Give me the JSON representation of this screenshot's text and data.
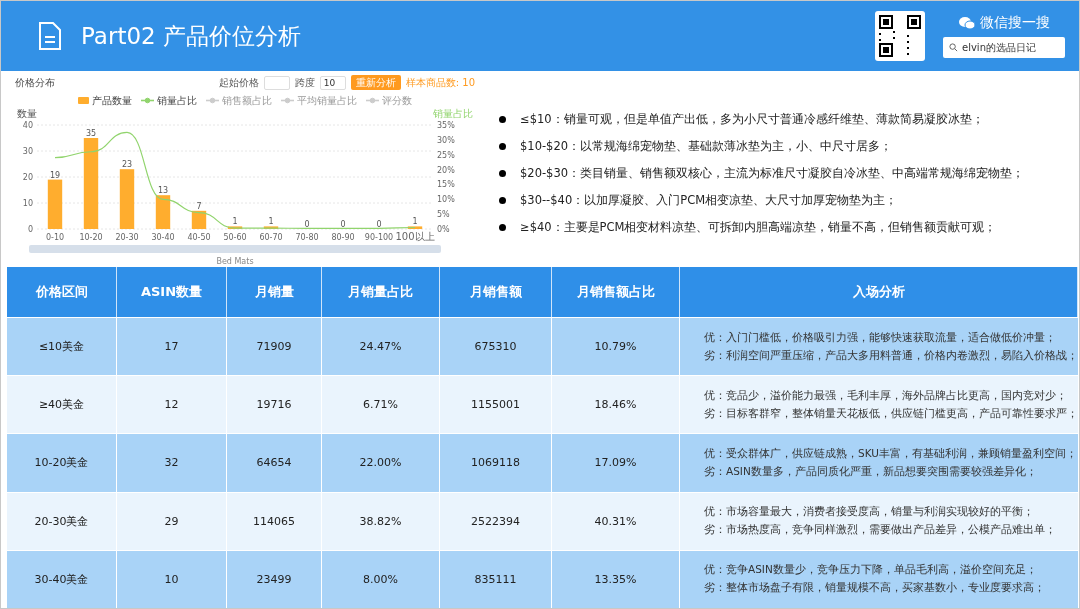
{
  "header": {
    "title": "Part02 产品价位分析",
    "wechat_label": "微信搜一搜",
    "search_value": "elvin的选品日记"
  },
  "chart_panel": {
    "title": "价格分布",
    "start_price_label": "起始价格",
    "span_label": "跨度",
    "span_value": "10",
    "analyze_button": "重新分析",
    "sample_count": "样本商品数: 10",
    "legend": [
      {
        "kind": "series",
        "selected": true
      },
      {
        "kind": "series",
        "selected": true
      },
      {
        "label": "销售额占比",
        "kind": "line",
        "selected": false
      },
      {
        "label": "平均销量占比",
        "kind": "line",
        "selected": false
      },
      {
        "label": "评分数",
        "kind": "line",
        "selected": false
      }
    ],
    "chart_data": {
      "type": "bar",
      "xlabel": "Bed Mats",
      "ylabel": "数量",
      "categories": [
        "0-10",
        "10-20",
        "20-30",
        "30-40",
        "40-50",
        "50-60",
        "60-70",
        "70-80",
        "80-90",
        "90-100",
        "100以上"
      ],
      "series": [
        {
          "name": "产品数量",
          "color": "#ffad2e",
          "values": [
            19,
            35,
            23,
            13,
            7,
            1,
            1,
            0,
            0,
            0,
            1
          ],
          "value_labels": [
            "19",
            "35",
            "23",
            "13",
            "7",
            "1",
            "1",
            "0",
            "0",
            "0",
            "1"
          ]
        },
        {
          "name": "销量占比",
          "type": "line",
          "axis": "y2",
          "color": "#91d46d",
          "values": [
            24,
            26,
            32.5,
            10,
            5.5,
            0.3,
            0.3,
            0.2,
            0.2,
            0.2,
            0.5
          ]
        }
      ],
      "grid": true,
      "ylim": [
        0,
        40
      ],
      "yticks": [
        0,
        10,
        20,
        30,
        40
      ],
      "y2label": "销量占比",
      "y2lim": [
        0,
        35
      ],
      "y2ticks": [
        {
          "value": 0,
          "label": "0%"
        },
        {
          "value": 5,
          "label": "5%"
        },
        {
          "value": 10,
          "label": "10%"
        },
        {
          "value": 15,
          "label": "15%"
        },
        {
          "value": 20,
          "label": "20%"
        },
        {
          "value": 25,
          "label": "25%"
        },
        {
          "value": 30,
          "label": "30%"
        },
        {
          "value": 35,
          "label": "35%"
        }
      ]
    }
  },
  "bullets": [
    "≤$10：销量可观，但是单值产出低，多为小尺寸普通冷感纤维垫、薄款简易凝胶冰垫；",
    "$10-$20：以常规海绵宠物垫、基础款薄冰垫为主，小、中尺寸居多；",
    "$20-$30：类目销量、销售额双核心，主流为标准尺寸凝胶自冷冰垫、中高端常规海绵宠物垫；",
    "$30--$40：以加厚凝胶、入门PCM相变凉垫、大尺寸加厚宠物垫为主；",
    "≥$40：主要是PCM相变材料凉垫、可拆卸内胆高端凉垫，销量不高，但销售额贡献可观；"
  ],
  "table": {
    "columns": [
      "价格区间",
      "ASIN数量",
      "月销量",
      "月销量占比",
      "月销售额",
      "月销售额占比",
      "入场分析"
    ],
    "rows": [
      {
        "cells": [
          "≤10美金",
          "17",
          "71909",
          "24.47%",
          "675310",
          "10.79%"
        ],
        "analysis": [
          "优：入门门槛低，价格吸引力强，能够快速获取流量，适合做低价冲量；",
          "劣：利润空间严重压缩，产品大多用料普通，价格内卷激烈，易陷入价格战；"
        ]
      },
      {
        "cells": [
          "≥40美金",
          "12",
          "19716",
          "6.71%",
          "1155001",
          "18.46%"
        ],
        "analysis": [
          "优：竞品少，溢价能力最强，毛利丰厚，海外品牌占比更高，国内竞对少；",
          "劣：目标客群窄，整体销量天花板低，供应链门槛更高，产品可靠性要求严；"
        ]
      },
      {
        "cells": [
          "10-20美金",
          "32",
          "64654",
          "22.00%",
          "1069118",
          "17.09%"
        ],
        "analysis": [
          "优：受众群体广，供应链成熟，SKU丰富，有基础利润，兼顾销量盈利空间；",
          "劣：ASIN数量多，产品同质化严重，新品想要突围需要较强差异化；"
        ]
      },
      {
        "cells": [
          "20-30美金",
          "29",
          "114065",
          "38.82%",
          "2522394",
          "40.31%"
        ],
        "analysis": [
          "优：市场容量最大，消费者接受度高，销量与利润实现较好的平衡；",
          "劣：市场热度高，竞争同样激烈，需要做出产品差异，公模产品难出单；"
        ]
      },
      {
        "cells": [
          "30-40美金",
          "10",
          "23499",
          "8.00%",
          "835111",
          "13.35%"
        ],
        "analysis": [
          "优：竞争ASIN数量少，竞争压力下降，单品毛利高，溢价空间充足；",
          "劣：整体市场盘子有限，销量规模不高，买家基数小，专业度要求高；"
        ]
      }
    ]
  }
}
